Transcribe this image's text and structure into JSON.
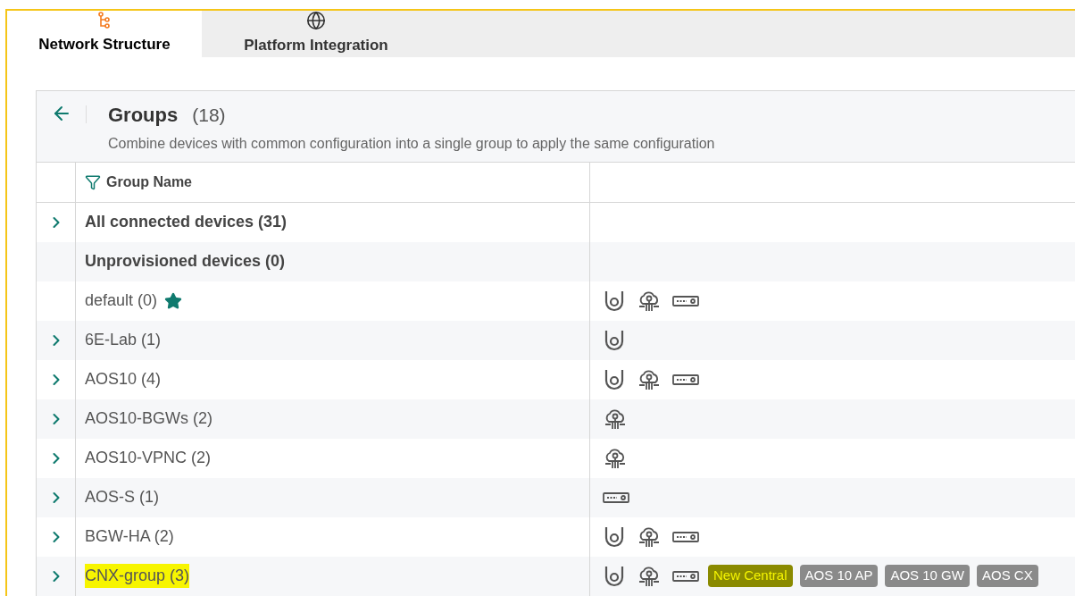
{
  "tabs": [
    {
      "label": "Network Structure",
      "selected": true
    },
    {
      "label": "Platform Integration",
      "selected": false
    }
  ],
  "groups": {
    "title": "Groups",
    "count": "(18)",
    "description": "Combine devices with common configuration into a single group to apply the same configuration",
    "columns": [
      "Group Name"
    ],
    "rows": [
      {
        "name": "All connected devices (31)",
        "bold": true,
        "expandable": true,
        "default": false,
        "highlighted": false,
        "devices": [],
        "tags": []
      },
      {
        "name": "Unprovisioned devices (0)",
        "bold": true,
        "expandable": false,
        "default": false,
        "highlighted": false,
        "devices": [],
        "tags": []
      },
      {
        "name": "default (0)",
        "bold": false,
        "expandable": false,
        "default": true,
        "highlighted": false,
        "devices": [
          {
            "kind": "ap"
          },
          {
            "kind": "gateway"
          },
          {
            "kind": "switch"
          }
        ],
        "tags": []
      },
      {
        "name": "6E-Lab (1)",
        "bold": false,
        "expandable": true,
        "default": false,
        "highlighted": false,
        "devices": [
          {
            "kind": "ap"
          }
        ],
        "tags": []
      },
      {
        "name": "AOS10 (4)",
        "bold": false,
        "expandable": true,
        "default": false,
        "highlighted": false,
        "devices": [
          {
            "kind": "ap"
          },
          {
            "kind": "gateway"
          },
          {
            "kind": "switch"
          }
        ],
        "tags": []
      },
      {
        "name": "AOS10-BGWs (2)",
        "bold": false,
        "expandable": true,
        "default": false,
        "highlighted": false,
        "devices": [
          {
            "kind": "gateway"
          }
        ],
        "tags": []
      },
      {
        "name": "AOS10-VPNC (2)",
        "bold": false,
        "expandable": true,
        "default": false,
        "highlighted": false,
        "devices": [
          {
            "kind": "gateway"
          }
        ],
        "tags": []
      },
      {
        "name": "AOS-S (1)",
        "bold": false,
        "expandable": true,
        "default": false,
        "highlighted": false,
        "devices": [
          {
            "kind": "switch"
          }
        ],
        "tags": []
      },
      {
        "name": "BGW-HA (2)",
        "bold": false,
        "expandable": true,
        "default": false,
        "highlighted": false,
        "devices": [
          {
            "kind": "ap"
          },
          {
            "kind": "gateway"
          },
          {
            "kind": "switch"
          }
        ],
        "tags": []
      },
      {
        "name": "CNX-group (3)",
        "bold": false,
        "expandable": true,
        "default": false,
        "highlighted": true,
        "devices": [
          {
            "kind": "ap"
          },
          {
            "kind": "gateway"
          },
          {
            "kind": "switch"
          }
        ],
        "tags": [
          {
            "label": "New Central",
            "highlighted": true
          },
          {
            "label": "AOS 10 AP",
            "highlighted": false
          },
          {
            "label": "AOS 10 GW",
            "highlighted": false
          },
          {
            "label": "AOS CX",
            "highlighted": false
          }
        ]
      }
    ]
  }
}
